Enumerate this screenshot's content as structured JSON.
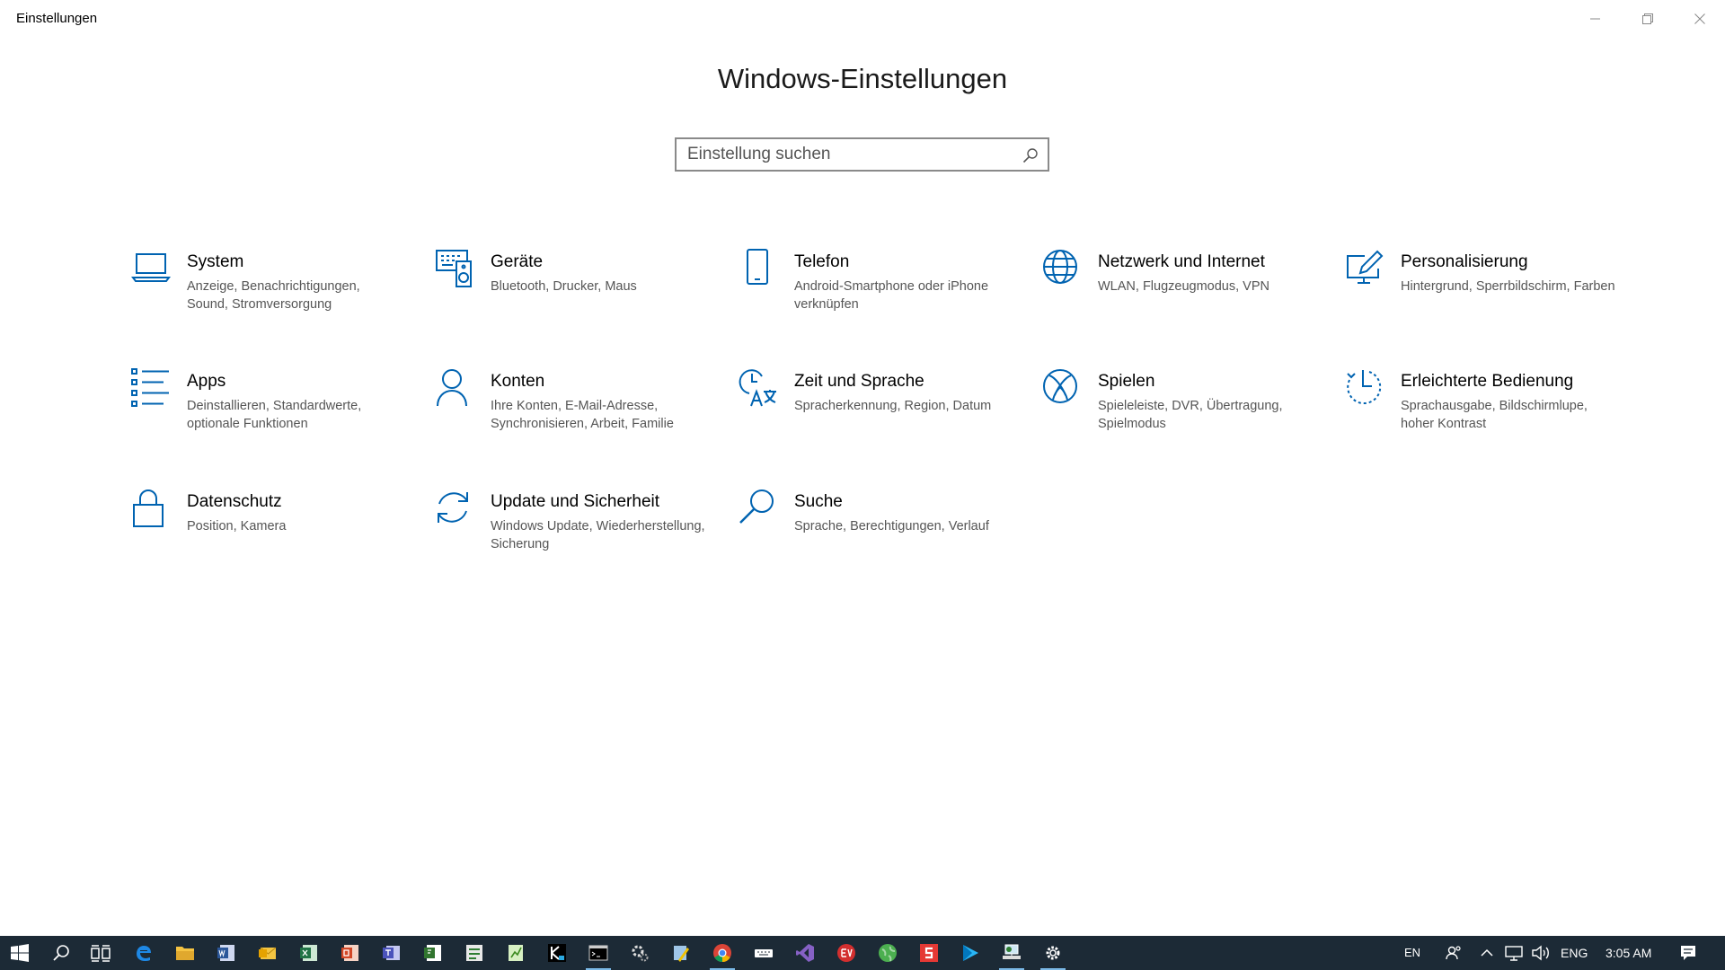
{
  "window": {
    "title": "Einstellungen"
  },
  "page_title": "Windows-Einstellungen",
  "search": {
    "placeholder": "Einstellung suchen"
  },
  "accent_color": "#0063b1",
  "categories": [
    {
      "name": "System",
      "desc": "Anzeige, Benachrichtigungen, Sound, Stromversorgung",
      "icon": "laptop-icon"
    },
    {
      "name": "Geräte",
      "desc": "Bluetooth, Drucker, Maus",
      "icon": "devices-icon"
    },
    {
      "name": "Telefon",
      "desc": "Android-Smartphone oder iPhone verknüpfen",
      "icon": "phone-icon"
    },
    {
      "name": "Netzwerk und Internet",
      "desc": "WLAN, Flugzeugmodus, VPN",
      "icon": "globe-icon"
    },
    {
      "name": "Personalisierung",
      "desc": "Hintergrund, Sperrbildschirm, Farben",
      "icon": "pen-screen-icon"
    },
    {
      "name": "Apps",
      "desc": "Deinstallieren, Standardwerte, optionale Funktionen",
      "icon": "apps-list-icon"
    },
    {
      "name": "Konten",
      "desc": "Ihre Konten, E-Mail-Adresse, Synchronisieren, Arbeit, Familie",
      "icon": "person-icon"
    },
    {
      "name": "Zeit und Sprache",
      "desc": "Spracherkennung, Region, Datum",
      "icon": "time-language-icon"
    },
    {
      "name": "Spielen",
      "desc": "Spieleleiste, DVR, Übertragung, Spielmodus",
      "icon": "xbox-icon"
    },
    {
      "name": "Erleichterte Bedienung",
      "desc": "Sprachausgabe, Bildschirmlupe, hoher Kontrast",
      "icon": "ease-of-access-icon"
    },
    {
      "name": "Datenschutz",
      "desc": "Position, Kamera",
      "icon": "lock-icon"
    },
    {
      "name": "Update und Sicherheit",
      "desc": "Windows Update, Wiederherstellung, Sicherung",
      "icon": "sync-icon"
    },
    {
      "name": "Suche",
      "desc": "Sprache, Berechtigungen, Verlauf",
      "icon": "search-icon"
    }
  ],
  "taskbar": {
    "apps": [
      "windows-start-icon",
      "cortana-search-icon",
      "task-view-icon",
      "edge-icon",
      "file-explorer-icon",
      "word-icon",
      "outlook-icon",
      "excel-icon",
      "powerpoint-icon",
      "teams-icon",
      "project-icon",
      "editor-icon",
      "spreadsheet-icon",
      "kotlin-icon",
      "terminal-icon",
      "settings-gear-icon",
      "paint-icon",
      "chrome-icon",
      "keyboard-icon",
      "visual-studio-icon",
      "ev-app-icon",
      "globe-app-icon",
      "stack-app-icon",
      "play-app-icon",
      "network-app-icon",
      "settings-icon"
    ],
    "tray": {
      "lang_short": "EN",
      "lang": "ENG",
      "time": "3:05 AM"
    }
  }
}
